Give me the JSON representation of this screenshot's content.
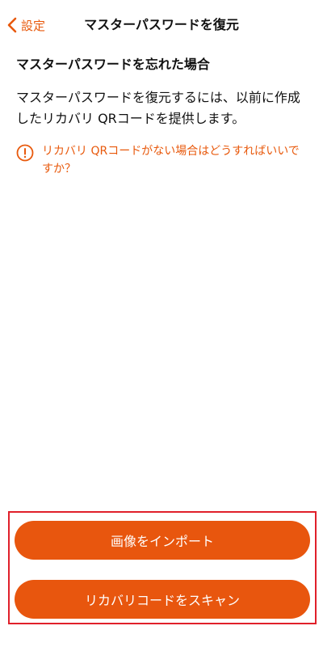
{
  "header": {
    "back_label": "設定",
    "title": "マスターパスワードを復元"
  },
  "main": {
    "heading": "マスターパスワードを忘れた場合",
    "description": "マスターパスワードを復元するには、以前に作成したリカバリ QRコードを提供します。",
    "help_link": "リカバリ QRコードがない場合はどうすればいいですか？"
  },
  "buttons": {
    "import_image": "画像をインポート",
    "scan_recovery_code": "リカバリコードをスキャン"
  },
  "colors": {
    "accent": "#E8590C",
    "button": "#E8560E",
    "highlight_border": "#E0202A"
  },
  "icons": {
    "back": "chevron-left-icon",
    "info": "info-circle-icon"
  }
}
